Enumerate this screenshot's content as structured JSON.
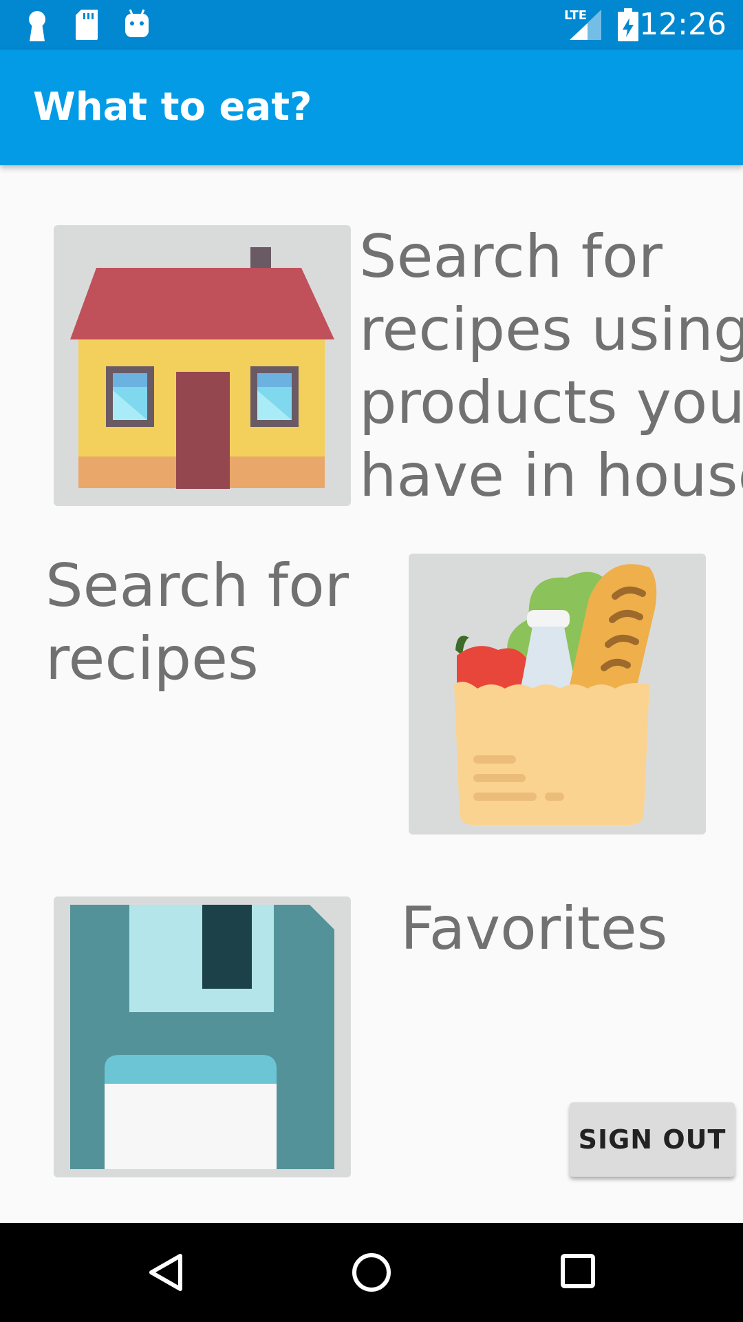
{
  "status_bar": {
    "time": "12:26",
    "network_label": "LTE",
    "icons": [
      "keyhole-icon",
      "sd-card-icon",
      "android-icon",
      "lte-signal-icon",
      "battery-charging-icon"
    ]
  },
  "app_bar": {
    "title": "What to eat?"
  },
  "menu": {
    "house_search": {
      "line1": "Search for",
      "line2": "recipes using",
      "line3": "products you",
      "line4": "have in house",
      "icon": "house-icon"
    },
    "recipe_search": {
      "line1": "Search for",
      "line2": "recipes",
      "icon": "grocery-bag-icon"
    },
    "favorites": {
      "label": "Favorites",
      "icon": "floppy-disk-icon"
    }
  },
  "sign_out_label": "SIGN OUT",
  "nav_bar": {
    "buttons": [
      "back-icon",
      "home-icon",
      "recents-icon"
    ]
  },
  "colors": {
    "status_bar": "#0288d1",
    "app_bar": "#039be5",
    "background": "#fafafa",
    "tile": "#d9dbdb",
    "caption_text": "#717171"
  }
}
